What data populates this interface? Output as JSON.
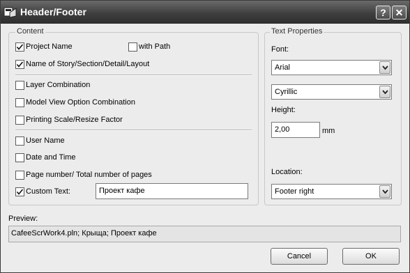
{
  "window": {
    "title": "Header/Footer",
    "help_label": "?",
    "close_label": "✕"
  },
  "content": {
    "group_label": "Content",
    "project_name": {
      "label": "Project Name",
      "checked": true
    },
    "with_path": {
      "label": "with Path",
      "checked": false
    },
    "story_name": {
      "label": "Name of Story/Section/Detail/Layout",
      "checked": true
    },
    "layer_combination": {
      "label": "Layer Combination",
      "checked": false
    },
    "model_view": {
      "label": "Model View Option Combination",
      "checked": false
    },
    "printing_scale": {
      "label": "Printing Scale/Resize Factor",
      "checked": false
    },
    "user_name": {
      "label": "User Name",
      "checked": false
    },
    "date_time": {
      "label": "Date and Time",
      "checked": false
    },
    "page_number": {
      "label": "Page number/ Total number of pages",
      "checked": false
    },
    "custom_text": {
      "label": "Custom Text:",
      "checked": true,
      "value": "Проект кафе"
    }
  },
  "text_properties": {
    "group_label": "Text Properties",
    "font_label": "Font:",
    "font_value": "Arial",
    "script_value": "Cyrillic",
    "height_label": "Height:",
    "height_value": "2,00",
    "height_unit": "mm",
    "location_label": "Location:",
    "location_value": "Footer right"
  },
  "preview": {
    "label": "Preview:",
    "value": "CafeeScrWork4.pln; Крыща; Проект кафе"
  },
  "buttons": {
    "cancel": "Cancel",
    "ok": "OK"
  }
}
